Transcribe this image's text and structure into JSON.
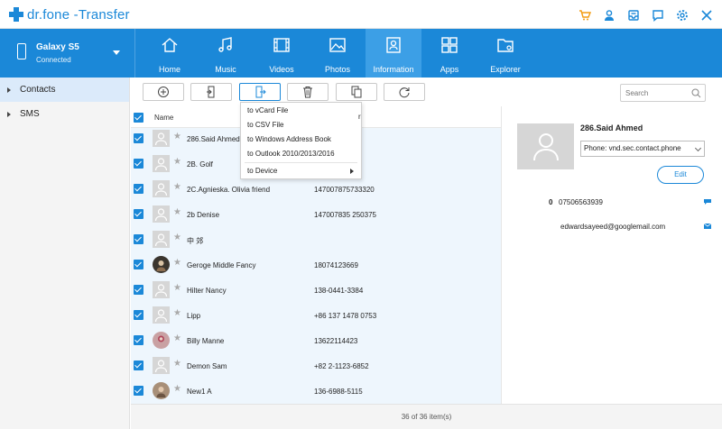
{
  "app": {
    "name": "dr.fone -Transfer"
  },
  "colors": {
    "accent": "#1b88d8",
    "cart": "#f39c12",
    "active_tab": "#3c9fe6"
  },
  "title_icons": [
    "cart-icon",
    "user-icon",
    "inbox-icon",
    "feedback-icon",
    "settings-icon",
    "close-icon"
  ],
  "device": {
    "name": "Galaxy S5",
    "status": "Connected"
  },
  "nav": {
    "tabs": [
      {
        "label": "Home",
        "icon": "home-icon"
      },
      {
        "label": "Music",
        "icon": "music-icon"
      },
      {
        "label": "Videos",
        "icon": "video-icon"
      },
      {
        "label": "Photos",
        "icon": "photo-icon"
      },
      {
        "label": "Information",
        "icon": "contact-card-icon",
        "active": true
      },
      {
        "label": "Apps",
        "icon": "apps-icon"
      },
      {
        "label": "Explorer",
        "icon": "folder-icon"
      }
    ]
  },
  "sidebar": {
    "items": [
      {
        "label": "Contacts",
        "active": true
      },
      {
        "label": "SMS",
        "active": false
      }
    ]
  },
  "toolbar": {
    "buttons": [
      "add-icon",
      "import-icon",
      "export-icon",
      "delete-icon",
      "copy-icon",
      "refresh-icon"
    ],
    "search_placeholder": "Search"
  },
  "list": {
    "header": {
      "name": "Name"
    },
    "rows": [
      {
        "name": "286.Said Ahmed",
        "phone": "",
        "avatar": "default"
      },
      {
        "name": "2B. Golf",
        "phone": "765",
        "avatar": "default"
      },
      {
        "name": "2C.Agnieska. Olivia friend",
        "phone": "147007875733320",
        "avatar": "default"
      },
      {
        "name": "2b Denise",
        "phone": "147007835 250375",
        "avatar": "default"
      },
      {
        "name": "中 郊",
        "phone": "",
        "avatar": "default"
      },
      {
        "name": "Geroge Middle Fancy",
        "phone": "18074123669",
        "avatar": "photo"
      },
      {
        "name": "Hilter  Nancy",
        "phone": "138-0441-3384",
        "avatar": "default"
      },
      {
        "name": "Lipp",
        "phone": "+86 137 1478 0753",
        "avatar": "default"
      },
      {
        "name": "Billy  Manne",
        "phone": "13622114423",
        "avatar": "photo2"
      },
      {
        "name": "Demon  Sam",
        "phone": "+82 2-1123-6852",
        "avatar": "default"
      },
      {
        "name": "New1  A",
        "phone": "136-6988-5115",
        "avatar": "photo3"
      }
    ]
  },
  "export_menu": {
    "items": [
      "to vCard File",
      "to CSV File",
      "to Windows Address Book",
      "to Outlook 2010/2013/2016"
    ],
    "device_item": "to Device",
    "header_fragment": "r"
  },
  "detail": {
    "name": "286.Said Ahmed",
    "phone_account": "Phone: vnd.sec.contact.phone",
    "edit_label": "Edit",
    "phone_label": "0",
    "phone_value": "07506563939",
    "email": "edwardsayeed@googlemail.com"
  },
  "footer": {
    "status": "36  of  36  item(s)"
  }
}
